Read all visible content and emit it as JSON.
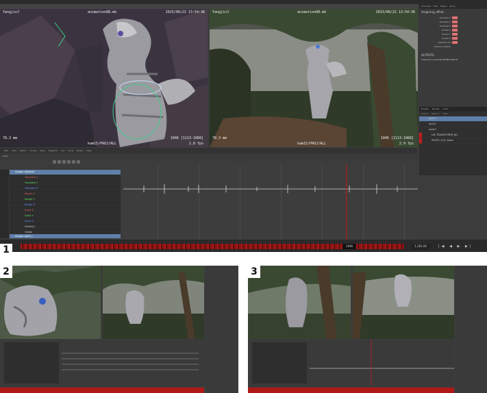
{
  "colors": {
    "accent_red": "#c41c1c",
    "selection_blue": "#5f7fa8",
    "viewport_dark": "#3b3440",
    "foliage": "#3a4a32"
  },
  "panel1": {
    "badge": "1",
    "menu": [
      "File",
      "Edit",
      "Modify",
      "Create",
      "Display",
      "Windows",
      "Mesh",
      "Edit Mesh",
      "Mesh Tools"
    ],
    "left_viewport": {
      "camera": "YangjinJ",
      "file": "animation08.mb",
      "timestamp": "2015/06/22 13:54:36",
      "lens": "78.3 mm",
      "frame": "1046 [1113-1068]",
      "cam_path": "kam15/PROJ/ALL",
      "fps": "1.8 fps"
    },
    "right_viewport": {
      "camera": "YangjinJ",
      "file": "animation08.mb",
      "timestamp": "2015/06/22 13:54:36",
      "lens": "78.3 mm",
      "frame": "1046 [1113-1068]",
      "cam_path": "kam15/PROJ/ALL",
      "fps": "2.9 fps"
    },
    "attr_editor": {
      "tabs": [
        "Channels",
        "Edit",
        "Object",
        "Show"
      ],
      "node": "dragonrig_offset",
      "channels": [
        "Translate X",
        "Translate Y",
        "Translate Z",
        "Rotate X",
        "Rotate Y",
        "Rotate Z",
        "Visibility Ctrl",
        "Display Visibility"
      ],
      "outputs_label": "OUTPUTS",
      "output_node": "dragonlocal_standard05/BleedNode"
    },
    "graph_editor": {
      "menu": [
        "Edit",
        "View",
        "Select",
        "Curves",
        "Keys",
        "Tangents",
        "List",
        "Show",
        "Buffer",
        "Help"
      ],
      "stats_label": "Stats"
    },
    "outliner": {
      "items": [
        "dragon:rigWorld",
        "Translate X",
        "Translate Y",
        "Translate Z",
        "Rotate X",
        "Rotate Y",
        "Rotate Z",
        "Scale X",
        "Scale Y",
        "Scale Z",
        "Visibility",
        "Global",
        "Eyes Ctrl",
        "dragon:rigFK_L"
      ],
      "selected": "dragon:rigWorld"
    },
    "layers": {
      "tabs": [
        "Display",
        "Render",
        "Anim"
      ],
      "menu": [
        "Layers",
        "Options",
        "Help"
      ],
      "items": [
        "layer3",
        "layer2",
        "layer1",
        "LIB_TRANSFORMS_BG",
        "PROPS_OUT_Mask"
      ]
    },
    "timeline": {
      "current_frame": "1046",
      "range_field": "1,181.00"
    }
  },
  "panel2": {
    "badge": "2"
  },
  "panel3": {
    "badge": "3"
  }
}
